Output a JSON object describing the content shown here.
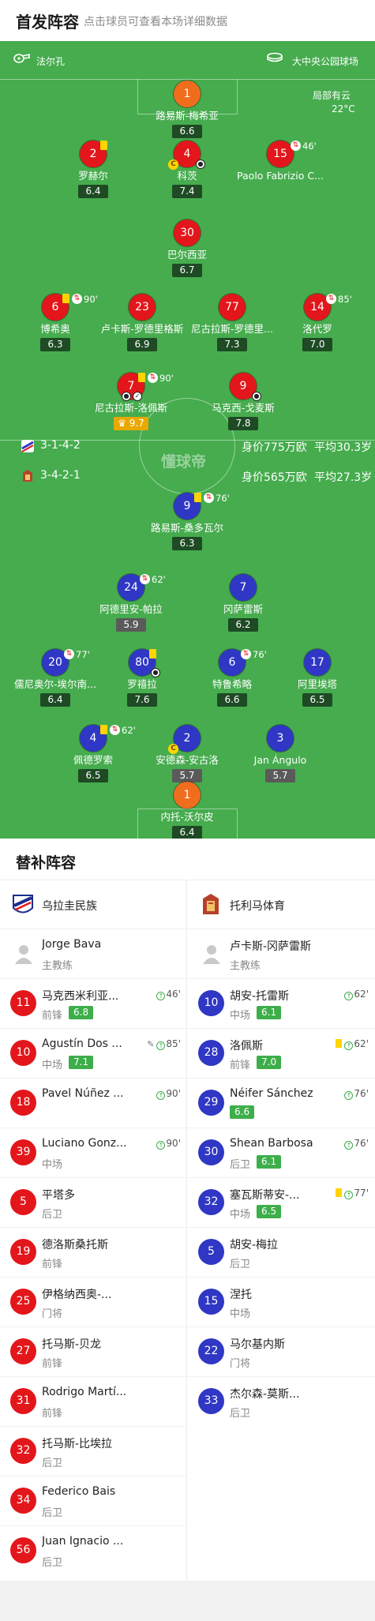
{
  "header": {
    "title": "首发阵容",
    "subtitle": "点击球员可查看本场详细数据"
  },
  "pitch": {
    "referee": "法尔孔",
    "stadium": "大中央公园球场",
    "weather": "局部有云",
    "temperature": "22°C",
    "watermark": "懂球帝"
  },
  "teams": {
    "home": {
      "formation": "3-1-4-2",
      "value": "身价775万欧",
      "age": "平均30.3岁"
    },
    "away": {
      "formation": "3-4-2-1",
      "value": "身价565万欧",
      "age": "平均27.3岁"
    }
  },
  "home_players": [
    {
      "num": "1",
      "name": "路易斯-梅希亚",
      "rating": "6.6",
      "color": "#f16d1e"
    },
    {
      "num": "2",
      "name": "罗赫尔",
      "rating": "6.4"
    },
    {
      "num": "4",
      "name": "科茨",
      "rating": "7.4"
    },
    {
      "num": "15",
      "name": "Paolo Fabrizio C...",
      "rating": "",
      "event": "46'"
    },
    {
      "num": "30",
      "name": "巴尔西亚",
      "rating": "6.7"
    },
    {
      "num": "6",
      "name": "博希奥",
      "rating": "6.3",
      "event": "90'"
    },
    {
      "num": "23",
      "name": "卢卡斯-罗德里格斯",
      "rating": "6.9"
    },
    {
      "num": "77",
      "name": "尼古拉斯-罗德里...",
      "rating": "7.3"
    },
    {
      "num": "14",
      "name": "洛代罗",
      "rating": "7.0",
      "event": "85'"
    },
    {
      "num": "7",
      "name": "尼古拉斯-洛佩斯",
      "rating": "9.7",
      "event": "90'"
    },
    {
      "num": "9",
      "name": "马克西-戈麦斯",
      "rating": "7.8"
    }
  ],
  "away_players": [
    {
      "num": "9",
      "name": "路易斯-桑多瓦尔",
      "rating": "6.3",
      "event": "76'"
    },
    {
      "num": "24",
      "name": "阿德里安-帕拉",
      "rating": "5.9",
      "event": "62'"
    },
    {
      "num": "7",
      "name": "冈萨雷斯",
      "rating": "6.2"
    },
    {
      "num": "20",
      "name": "儒尼奥尔-埃尔南...",
      "rating": "6.4",
      "event": "77'"
    },
    {
      "num": "80",
      "name": "罗禧拉",
      "rating": "7.6"
    },
    {
      "num": "6",
      "name": "特鲁希略",
      "rating": "6.6",
      "event": "76'"
    },
    {
      "num": "17",
      "name": "阿里埃塔",
      "rating": "6.5"
    },
    {
      "num": "4",
      "name": "佩德罗索",
      "rating": "6.5",
      "event": "62'"
    },
    {
      "num": "2",
      "name": "安德森-安古洛",
      "rating": "5.7"
    },
    {
      "num": "3",
      "name": "Jan Ángulo",
      "rating": "5.7"
    },
    {
      "num": "1",
      "name": "内托-沃尔皮",
      "rating": "6.4",
      "color": "#f16d1e"
    }
  ],
  "subs": {
    "title": "替补阵容",
    "home": {
      "team": "乌拉圭民族",
      "coach": {
        "name": "Jorge Bava",
        "role": "主教练"
      },
      "players": [
        {
          "num": "11",
          "name": "马克西米利亚...",
          "pos": "前锋",
          "rating": "6.8",
          "sub": "46'"
        },
        {
          "num": "10",
          "name": "Agustín Dos ...",
          "pos": "中场",
          "rating": "7.1",
          "sub": "85'"
        },
        {
          "num": "18",
          "name": "Pavel Núñez ...",
          "pos": "",
          "rating": "",
          "sub": "90'"
        },
        {
          "num": "39",
          "name": "Luciano Gonz...",
          "pos": "中场",
          "rating": "",
          "sub": "90'"
        },
        {
          "num": "5",
          "name": "平塔多",
          "pos": "后卫",
          "rating": "",
          "sub": ""
        },
        {
          "num": "19",
          "name": "德洛斯桑托斯",
          "pos": "前锋",
          "rating": "",
          "sub": ""
        },
        {
          "num": "25",
          "name": "伊格纳西奥-...",
          "pos": "门将",
          "rating": "",
          "sub": ""
        },
        {
          "num": "27",
          "name": "托马斯-贝龙",
          "pos": "前锋",
          "rating": "",
          "sub": ""
        },
        {
          "num": "31",
          "name": "Rodrigo Martí...",
          "pos": "前锋",
          "rating": "",
          "sub": ""
        },
        {
          "num": "32",
          "name": "托马斯-比埃拉",
          "pos": "后卫",
          "rating": "",
          "sub": ""
        },
        {
          "num": "34",
          "name": "Federico Bais",
          "pos": "后卫",
          "rating": "",
          "sub": ""
        },
        {
          "num": "56",
          "name": "Juan Ignacio ...",
          "pos": "后卫",
          "rating": "",
          "sub": ""
        }
      ]
    },
    "away": {
      "team": "托利马体育",
      "coach": {
        "name": "卢卡斯-冈萨雷斯",
        "role": "主教练"
      },
      "players": [
        {
          "num": "10",
          "name": "胡安-托雷斯",
          "pos": "中场",
          "rating": "6.1",
          "sub": "62'"
        },
        {
          "num": "28",
          "name": "洛佩斯",
          "pos": "前锋",
          "rating": "7.0",
          "sub": "62'"
        },
        {
          "num": "29",
          "name": "Néifer Sánchez",
          "pos": "",
          "rating": "6.6",
          "sub": "76'"
        },
        {
          "num": "30",
          "name": "Shean Barbosa",
          "pos": "后卫",
          "rating": "6.1",
          "sub": "76'"
        },
        {
          "num": "32",
          "name": "塞瓦斯蒂安-...",
          "pos": "中场",
          "rating": "6.5",
          "sub": "77'"
        },
        {
          "num": "5",
          "name": "胡安-梅拉",
          "pos": "后卫",
          "rating": "",
          "sub": ""
        },
        {
          "num": "15",
          "name": "涅托",
          "pos": "中场",
          "rating": "",
          "sub": ""
        },
        {
          "num": "22",
          "name": "马尔基内斯",
          "pos": "门将",
          "rating": "",
          "sub": ""
        },
        {
          "num": "33",
          "name": "杰尔森-莫斯...",
          "pos": "后卫",
          "rating": "",
          "sub": ""
        }
      ]
    }
  }
}
